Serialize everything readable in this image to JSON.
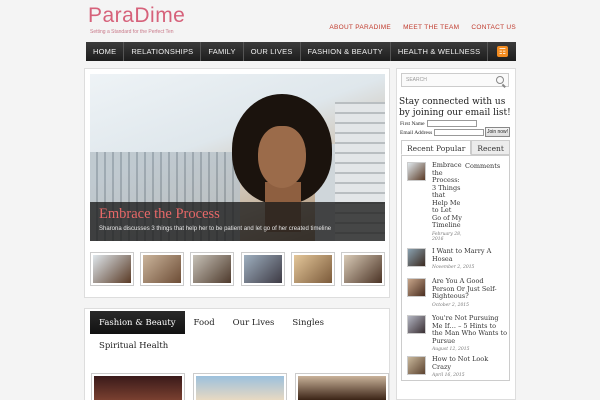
{
  "header": {
    "logo_text": "ParaDime",
    "tagline": "Setting a Standard for the Perfect Ten",
    "top_links": [
      "ABOUT PARADIME",
      "MEET THE TEAM",
      "CONTACT US"
    ]
  },
  "nav": {
    "items": [
      "HOME",
      "RELATIONSHIPS",
      "FAMILY",
      "OUR LIVES",
      "FASHION & BEAUTY",
      "HEALTH & WELLNESS"
    ],
    "rss_icon": "rss-icon"
  },
  "featured": {
    "title": "Embrace the Process",
    "subtitle": "Sharona discusses 3 things that help her to be patient and let go of her created timeline"
  },
  "categories": {
    "tabs": [
      "Fashion & Beauty",
      "Food",
      "Our Lives",
      "Singles",
      "Spiritual Health"
    ],
    "active": "Fashion & Beauty"
  },
  "sidebar": {
    "search_placeholder": "SEARCH",
    "newsletter_heading": "Stay connected with us by joining our email list!",
    "first_name_label": "First Name",
    "email_label": "Email Address",
    "join_label": "Join now!",
    "tabs": [
      "Recent Popular",
      "Recent",
      "Comments"
    ],
    "posts": [
      {
        "title": "Embrace the Process: 3 Things that Help Me to Let Go of My Timeline",
        "date": "February 28, 2016"
      },
      {
        "title": "I Want to Marry A Hosea",
        "date": "November 2, 2015"
      },
      {
        "title": "Are You A Good Person Or Just Self-Righteous?",
        "date": "October 2, 2015"
      },
      {
        "title": "You're Not Pursuing Me If… – 5 Hints to the Man Who Wants to Pursue",
        "date": "August 12, 2015"
      },
      {
        "title": "How to Not Look Crazy",
        "date": "April 16, 2015"
      }
    ]
  },
  "colors": {
    "brand_pink": "#d6617a",
    "link_red": "#c0392b",
    "nav_dark": "#222222",
    "rss_orange": "#f28b20"
  }
}
